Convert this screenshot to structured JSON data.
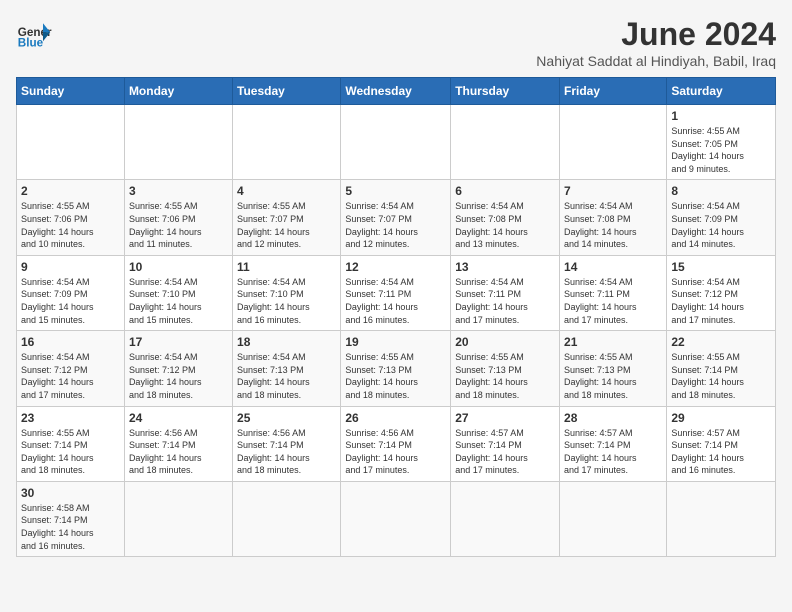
{
  "header": {
    "logo_general": "General",
    "logo_blue": "Blue",
    "month_title": "June 2024",
    "subtitle": "Nahiyat Saddat al Hindiyah, Babil, Iraq"
  },
  "weekdays": [
    "Sunday",
    "Monday",
    "Tuesday",
    "Wednesday",
    "Thursday",
    "Friday",
    "Saturday"
  ],
  "weeks": [
    [
      {
        "day": "",
        "info": ""
      },
      {
        "day": "",
        "info": ""
      },
      {
        "day": "",
        "info": ""
      },
      {
        "day": "",
        "info": ""
      },
      {
        "day": "",
        "info": ""
      },
      {
        "day": "",
        "info": ""
      },
      {
        "day": "1",
        "info": "Sunrise: 4:55 AM\nSunset: 7:05 PM\nDaylight: 14 hours\nand 9 minutes."
      }
    ],
    [
      {
        "day": "2",
        "info": "Sunrise: 4:55 AM\nSunset: 7:06 PM\nDaylight: 14 hours\nand 10 minutes."
      },
      {
        "day": "3",
        "info": "Sunrise: 4:55 AM\nSunset: 7:06 PM\nDaylight: 14 hours\nand 11 minutes."
      },
      {
        "day": "4",
        "info": "Sunrise: 4:55 AM\nSunset: 7:07 PM\nDaylight: 14 hours\nand 12 minutes."
      },
      {
        "day": "5",
        "info": "Sunrise: 4:54 AM\nSunset: 7:07 PM\nDaylight: 14 hours\nand 12 minutes."
      },
      {
        "day": "6",
        "info": "Sunrise: 4:54 AM\nSunset: 7:08 PM\nDaylight: 14 hours\nand 13 minutes."
      },
      {
        "day": "7",
        "info": "Sunrise: 4:54 AM\nSunset: 7:08 PM\nDaylight: 14 hours\nand 14 minutes."
      },
      {
        "day": "8",
        "info": "Sunrise: 4:54 AM\nSunset: 7:09 PM\nDaylight: 14 hours\nand 14 minutes."
      }
    ],
    [
      {
        "day": "9",
        "info": "Sunrise: 4:54 AM\nSunset: 7:09 PM\nDaylight: 14 hours\nand 15 minutes."
      },
      {
        "day": "10",
        "info": "Sunrise: 4:54 AM\nSunset: 7:10 PM\nDaylight: 14 hours\nand 15 minutes."
      },
      {
        "day": "11",
        "info": "Sunrise: 4:54 AM\nSunset: 7:10 PM\nDaylight: 14 hours\nand 16 minutes."
      },
      {
        "day": "12",
        "info": "Sunrise: 4:54 AM\nSunset: 7:11 PM\nDaylight: 14 hours\nand 16 minutes."
      },
      {
        "day": "13",
        "info": "Sunrise: 4:54 AM\nSunset: 7:11 PM\nDaylight: 14 hours\nand 17 minutes."
      },
      {
        "day": "14",
        "info": "Sunrise: 4:54 AM\nSunset: 7:11 PM\nDaylight: 14 hours\nand 17 minutes."
      },
      {
        "day": "15",
        "info": "Sunrise: 4:54 AM\nSunset: 7:12 PM\nDaylight: 14 hours\nand 17 minutes."
      }
    ],
    [
      {
        "day": "16",
        "info": "Sunrise: 4:54 AM\nSunset: 7:12 PM\nDaylight: 14 hours\nand 17 minutes."
      },
      {
        "day": "17",
        "info": "Sunrise: 4:54 AM\nSunset: 7:12 PM\nDaylight: 14 hours\nand 18 minutes."
      },
      {
        "day": "18",
        "info": "Sunrise: 4:54 AM\nSunset: 7:13 PM\nDaylight: 14 hours\nand 18 minutes."
      },
      {
        "day": "19",
        "info": "Sunrise: 4:55 AM\nSunset: 7:13 PM\nDaylight: 14 hours\nand 18 minutes."
      },
      {
        "day": "20",
        "info": "Sunrise: 4:55 AM\nSunset: 7:13 PM\nDaylight: 14 hours\nand 18 minutes."
      },
      {
        "day": "21",
        "info": "Sunrise: 4:55 AM\nSunset: 7:13 PM\nDaylight: 14 hours\nand 18 minutes."
      },
      {
        "day": "22",
        "info": "Sunrise: 4:55 AM\nSunset: 7:14 PM\nDaylight: 14 hours\nand 18 minutes."
      }
    ],
    [
      {
        "day": "23",
        "info": "Sunrise: 4:55 AM\nSunset: 7:14 PM\nDaylight: 14 hours\nand 18 minutes."
      },
      {
        "day": "24",
        "info": "Sunrise: 4:56 AM\nSunset: 7:14 PM\nDaylight: 14 hours\nand 18 minutes."
      },
      {
        "day": "25",
        "info": "Sunrise: 4:56 AM\nSunset: 7:14 PM\nDaylight: 14 hours\nand 18 minutes."
      },
      {
        "day": "26",
        "info": "Sunrise: 4:56 AM\nSunset: 7:14 PM\nDaylight: 14 hours\nand 17 minutes."
      },
      {
        "day": "27",
        "info": "Sunrise: 4:57 AM\nSunset: 7:14 PM\nDaylight: 14 hours\nand 17 minutes."
      },
      {
        "day": "28",
        "info": "Sunrise: 4:57 AM\nSunset: 7:14 PM\nDaylight: 14 hours\nand 17 minutes."
      },
      {
        "day": "29",
        "info": "Sunrise: 4:57 AM\nSunset: 7:14 PM\nDaylight: 14 hours\nand 16 minutes."
      }
    ],
    [
      {
        "day": "30",
        "info": "Sunrise: 4:58 AM\nSunset: 7:14 PM\nDaylight: 14 hours\nand 16 minutes."
      },
      {
        "day": "",
        "info": ""
      },
      {
        "day": "",
        "info": ""
      },
      {
        "day": "",
        "info": ""
      },
      {
        "day": "",
        "info": ""
      },
      {
        "day": "",
        "info": ""
      },
      {
        "day": "",
        "info": ""
      }
    ]
  ]
}
